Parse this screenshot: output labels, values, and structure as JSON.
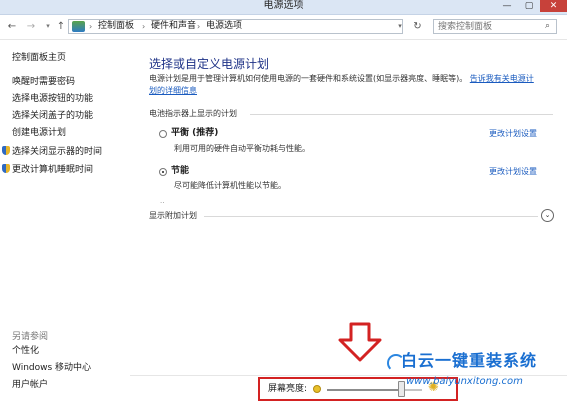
{
  "window": {
    "title": "电源选项",
    "min_icon": "minimize-icon",
    "max_icon": "maximize-icon",
    "close_icon": "close-icon"
  },
  "address_bar": {
    "breadcrumbs": [
      "控制面板",
      "硬件和声音",
      "电源选项"
    ],
    "search_placeholder": "搜索控制面板"
  },
  "sidebar": {
    "items": [
      {
        "label": "控制面板主页",
        "shield": false
      },
      {
        "label": "唤醒时需要密码",
        "shield": false
      },
      {
        "label": "选择电源按钮的功能",
        "shield": false
      },
      {
        "label": "选择关闭盖子的功能",
        "shield": false
      },
      {
        "label": "创建电源计划",
        "shield": false
      },
      {
        "label": "选择关闭显示器的时间",
        "shield": true
      },
      {
        "label": "更改计算机睡眠时间",
        "shield": true
      }
    ],
    "see_also": {
      "heading": "另请参阅",
      "items": [
        "个性化",
        "Windows 移动中心",
        "用户帐户"
      ]
    }
  },
  "main": {
    "title": "选择或自定义电源计划",
    "description": "电源计划是用于管理计算机如何使用电源的一套硬件和系统设置(如显示器亮度、睡眠等)。",
    "learn_more_1": "告诉我有关电源计",
    "learn_more_2": "划的详细信息",
    "battery_section": "电池指示器上显示的计划",
    "plans": [
      {
        "name": "平衡 (推荐)",
        "desc": "利用可用的硬件自动平衡功耗与性能。",
        "selected": false,
        "change": "更改计划设置"
      },
      {
        "name": "节能",
        "desc": "尽可能降低计算机性能以节能。",
        "selected": true,
        "change": "更改计划设置"
      }
    ],
    "more_plans": "显示附加计划"
  },
  "brightness": {
    "label": "屏幕亮度:",
    "level": 0.78,
    "dim_icon": "dim-sun-icon",
    "bright_icon": "bright-sun-icon"
  },
  "watermark": {
    "title": "白云一键重装系统",
    "url": "www.baiyunxitong.com"
  },
  "colors": {
    "link": "#1a5bbf",
    "title": "#1e3287",
    "highlight": "#d32222",
    "watermark": "#1a6fd1"
  }
}
